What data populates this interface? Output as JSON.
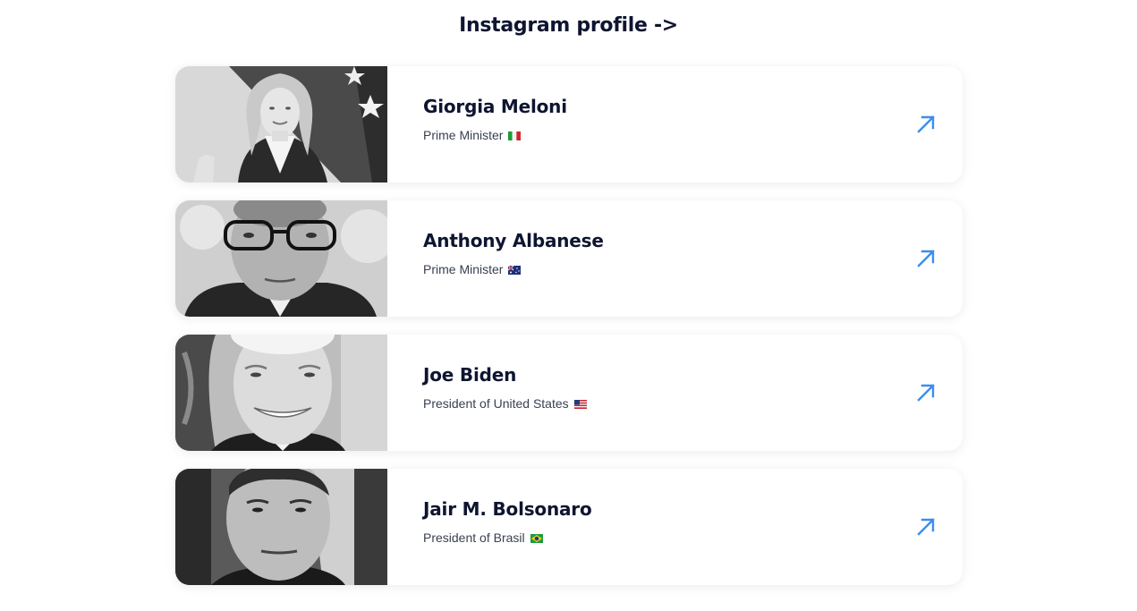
{
  "heading": "Instagram profile ->",
  "profiles": [
    {
      "name": "Giorgia Meloni",
      "role": "Prime Minister",
      "flag_icon": "italy-flag-icon",
      "photo": "giorgia-meloni-photo"
    },
    {
      "name": "Anthony Albanese",
      "role": "Prime Minister",
      "flag_icon": "australia-flag-icon",
      "photo": "anthony-albanese-photo"
    },
    {
      "name": "Joe Biden",
      "role": "President of United States",
      "flag_icon": "usa-flag-icon",
      "photo": "joe-biden-photo"
    },
    {
      "name": "Jair M. Bolsonaro",
      "role": "President of Brasil",
      "flag_icon": "brazil-flag-icon",
      "photo": "jair-bolsonaro-photo"
    }
  ],
  "arrow_icon": "arrow-up-right-icon",
  "colors": {
    "heading": "#0e1530",
    "text": "#3a4052",
    "arrow": "#3b8ef0",
    "card_bg": "#ffffff"
  }
}
